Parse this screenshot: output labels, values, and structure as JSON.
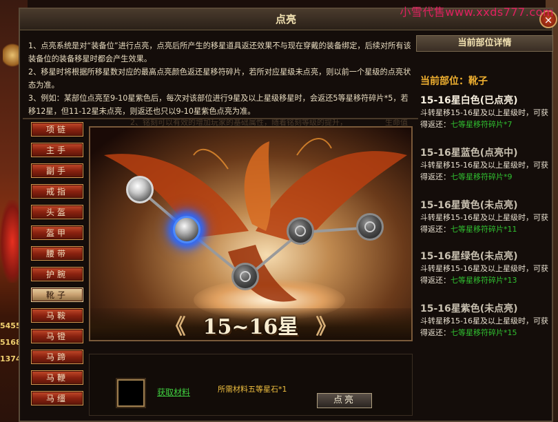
{
  "watermark": "小雪代售www.xxds777.com",
  "background": {
    "nums": [
      "5455",
      "5168",
      "1374"
    ]
  },
  "window": {
    "title": "点亮",
    "close": "×"
  },
  "description": [
    "1、点亮系统是对“装备位”进行点亮，点亮后所产生的移星道具返还效果不与现在穿戴的装备绑定，后续对所有该装备位的装备移星时都会产生效果。",
    "2、移星时将根据所移星数对应的最高点亮颜色返还星移符碎片，若所对应星级未点亮，则以前一个星级的点亮状态为准。",
    "3、例如：某部位点亮至9-10星紫色后，每次对该部位进行9星及以上星级移星时，会返还5等星移符碎片*5，若移12星，但11-12星未点亮，则返还也只以9-10星紫色点亮为准。"
  ],
  "ghost_text": {
    "line": "2、铭刻可以有效的增加玩家的基础属性，随着铭刻等级的提升，",
    "tag": "铭刻",
    "life": "生命值"
  },
  "menu": {
    "active": 8,
    "items": [
      "项链",
      "主手",
      "副手",
      "戒指",
      "头盔",
      "盔甲",
      "腰带",
      "护腕",
      "靴子",
      "马鞍",
      "马镫",
      "马蹄",
      "马鞭",
      "马缰"
    ]
  },
  "stage": {
    "star_range": "15~16星",
    "chevron_left": "《",
    "chevron_right": "》",
    "nodes": [
      {
        "name": "node-white",
        "state": "lit"
      },
      {
        "name": "node-blue",
        "state": "lighting"
      },
      {
        "name": "node-yellow",
        "state": "locked"
      },
      {
        "name": "node-green",
        "state": "locked"
      },
      {
        "name": "node-purple",
        "state": "locked"
      }
    ]
  },
  "bottom": {
    "get_material": "获取材料",
    "required": "所需材料五等星石*1",
    "light_button": "点亮"
  },
  "detail": {
    "header": "当前部位详情",
    "part": "当前部位：靴子",
    "levels": [
      {
        "title": "15-16星白色(已点亮)",
        "desc": "斗转星移15-16星及以上星级时，可获得返还：",
        "reward": "七等星移符碎片*7",
        "lit": true
      },
      {
        "title": "15-16星蓝色(点亮中)",
        "desc": "斗转星移15-16星及以上星级时，可获得返还：",
        "reward": "七等星移符碎片*9",
        "lit": false
      },
      {
        "title": "15-16星黄色(未点亮)",
        "desc": "斗转星移15-16星及以上星级时，可获得返还：",
        "reward": "七等星移符碎片*11",
        "lit": false
      },
      {
        "title": "15-16星绿色(未点亮)",
        "desc": "斗转星移15-16星及以上星级时，可获得返还：",
        "reward": "七等星移符碎片*13",
        "lit": false
      },
      {
        "title": "15-16星紫色(未点亮)",
        "desc": "斗转星移15-16星及以上星级时，可获得返还：",
        "reward": "七等星移符碎片*15",
        "lit": false
      }
    ]
  },
  "colors": {
    "accent": "#f0b030",
    "reward": "#30c030",
    "menu_red": "#8a2210",
    "highlight_blue": "#2a6aff"
  }
}
